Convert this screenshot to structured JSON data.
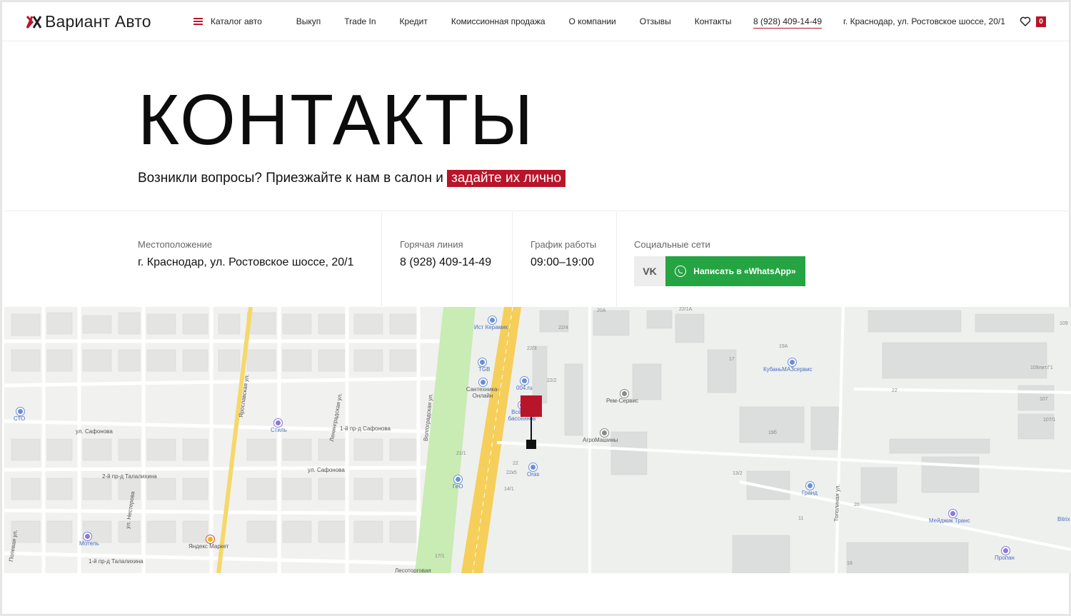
{
  "header": {
    "logo_text": "Вариант Авто",
    "nav": [
      {
        "label": "Каталог авто"
      },
      {
        "label": "Выкуп"
      },
      {
        "label": "Trade In"
      },
      {
        "label": "Кредит"
      },
      {
        "label": "Комиссионная продажа"
      },
      {
        "label": "О компании"
      },
      {
        "label": "Отзывы"
      },
      {
        "label": "Контакты"
      }
    ],
    "phone": "8 (928) 409-14-49",
    "address": "г. Краснодар, ул. Ростовское шоссе, 20/1",
    "favorites_count": "0"
  },
  "hero": {
    "title": "КОНТАКТЫ",
    "subtitle": "Возникли вопросы? Приезжайте к нам в салон и",
    "subtitle_highlight": "задайте их лично"
  },
  "info": {
    "location_label": "Местоположение",
    "location_value": "г. Краснодар, ул. Ростовское шоссе, 20/1",
    "hotline_label": "Горячая линия",
    "hotline_value": "8 (928) 409-14-49",
    "schedule_label": "График работы",
    "schedule_value": "09:00–19:00",
    "social_label": "Социальные сети",
    "vk_label": "VK",
    "whatsapp_label": "Написать в «WhatsApp»"
  },
  "map": {
    "pois": [
      {
        "label": "Ист Керамик"
      },
      {
        "label": "TGB"
      },
      {
        "label": "Сантехника-Онлайн"
      },
      {
        "label": "004.ru"
      },
      {
        "label": "Всё для бассейнов"
      },
      {
        "label": "Рем-Сервис"
      },
      {
        "label": "АгроМашины"
      },
      {
        "label": "КубаньМАЗсервис"
      },
      {
        "label": "Orаs"
      },
      {
        "label": "ГеО"
      },
      {
        "label": "Гранд"
      },
      {
        "label": "Мейджик Транс"
      },
      {
        "label": "Пропан"
      },
      {
        "label": "СТО"
      },
      {
        "label": "Стиль"
      },
      {
        "label": "Мотель"
      },
      {
        "label": "Яндекс Маркет"
      },
      {
        "label": "Bitrix"
      }
    ],
    "streets": [
      {
        "label": "ул. Сафонова"
      },
      {
        "label": "1-й пр-д Сафонова"
      },
      {
        "label": "ул. Сафонова"
      },
      {
        "label": "2-й пр-д Талалихина"
      },
      {
        "label": "1-й пр-д Талалихина"
      },
      {
        "label": "Ярославская ул."
      },
      {
        "label": "Ленинградская ул."
      },
      {
        "label": "Волгоградская ул."
      },
      {
        "label": "Тополиная ул."
      },
      {
        "label": "Полевая ул."
      },
      {
        "label": "ул. Нестерова"
      },
      {
        "label": "Лесоторговая"
      }
    ],
    "numbers": [
      "20А",
      "22/1А",
      "22/4",
      "22/3",
      "22/2",
      "17",
      "19А",
      "109лит.Г1",
      "22",
      "107",
      "107/1",
      "19б",
      "13/2",
      "20",
      "11",
      "18",
      "21/1",
      "22",
      "22к5",
      "14/1",
      "17/1",
      "109"
    ]
  }
}
